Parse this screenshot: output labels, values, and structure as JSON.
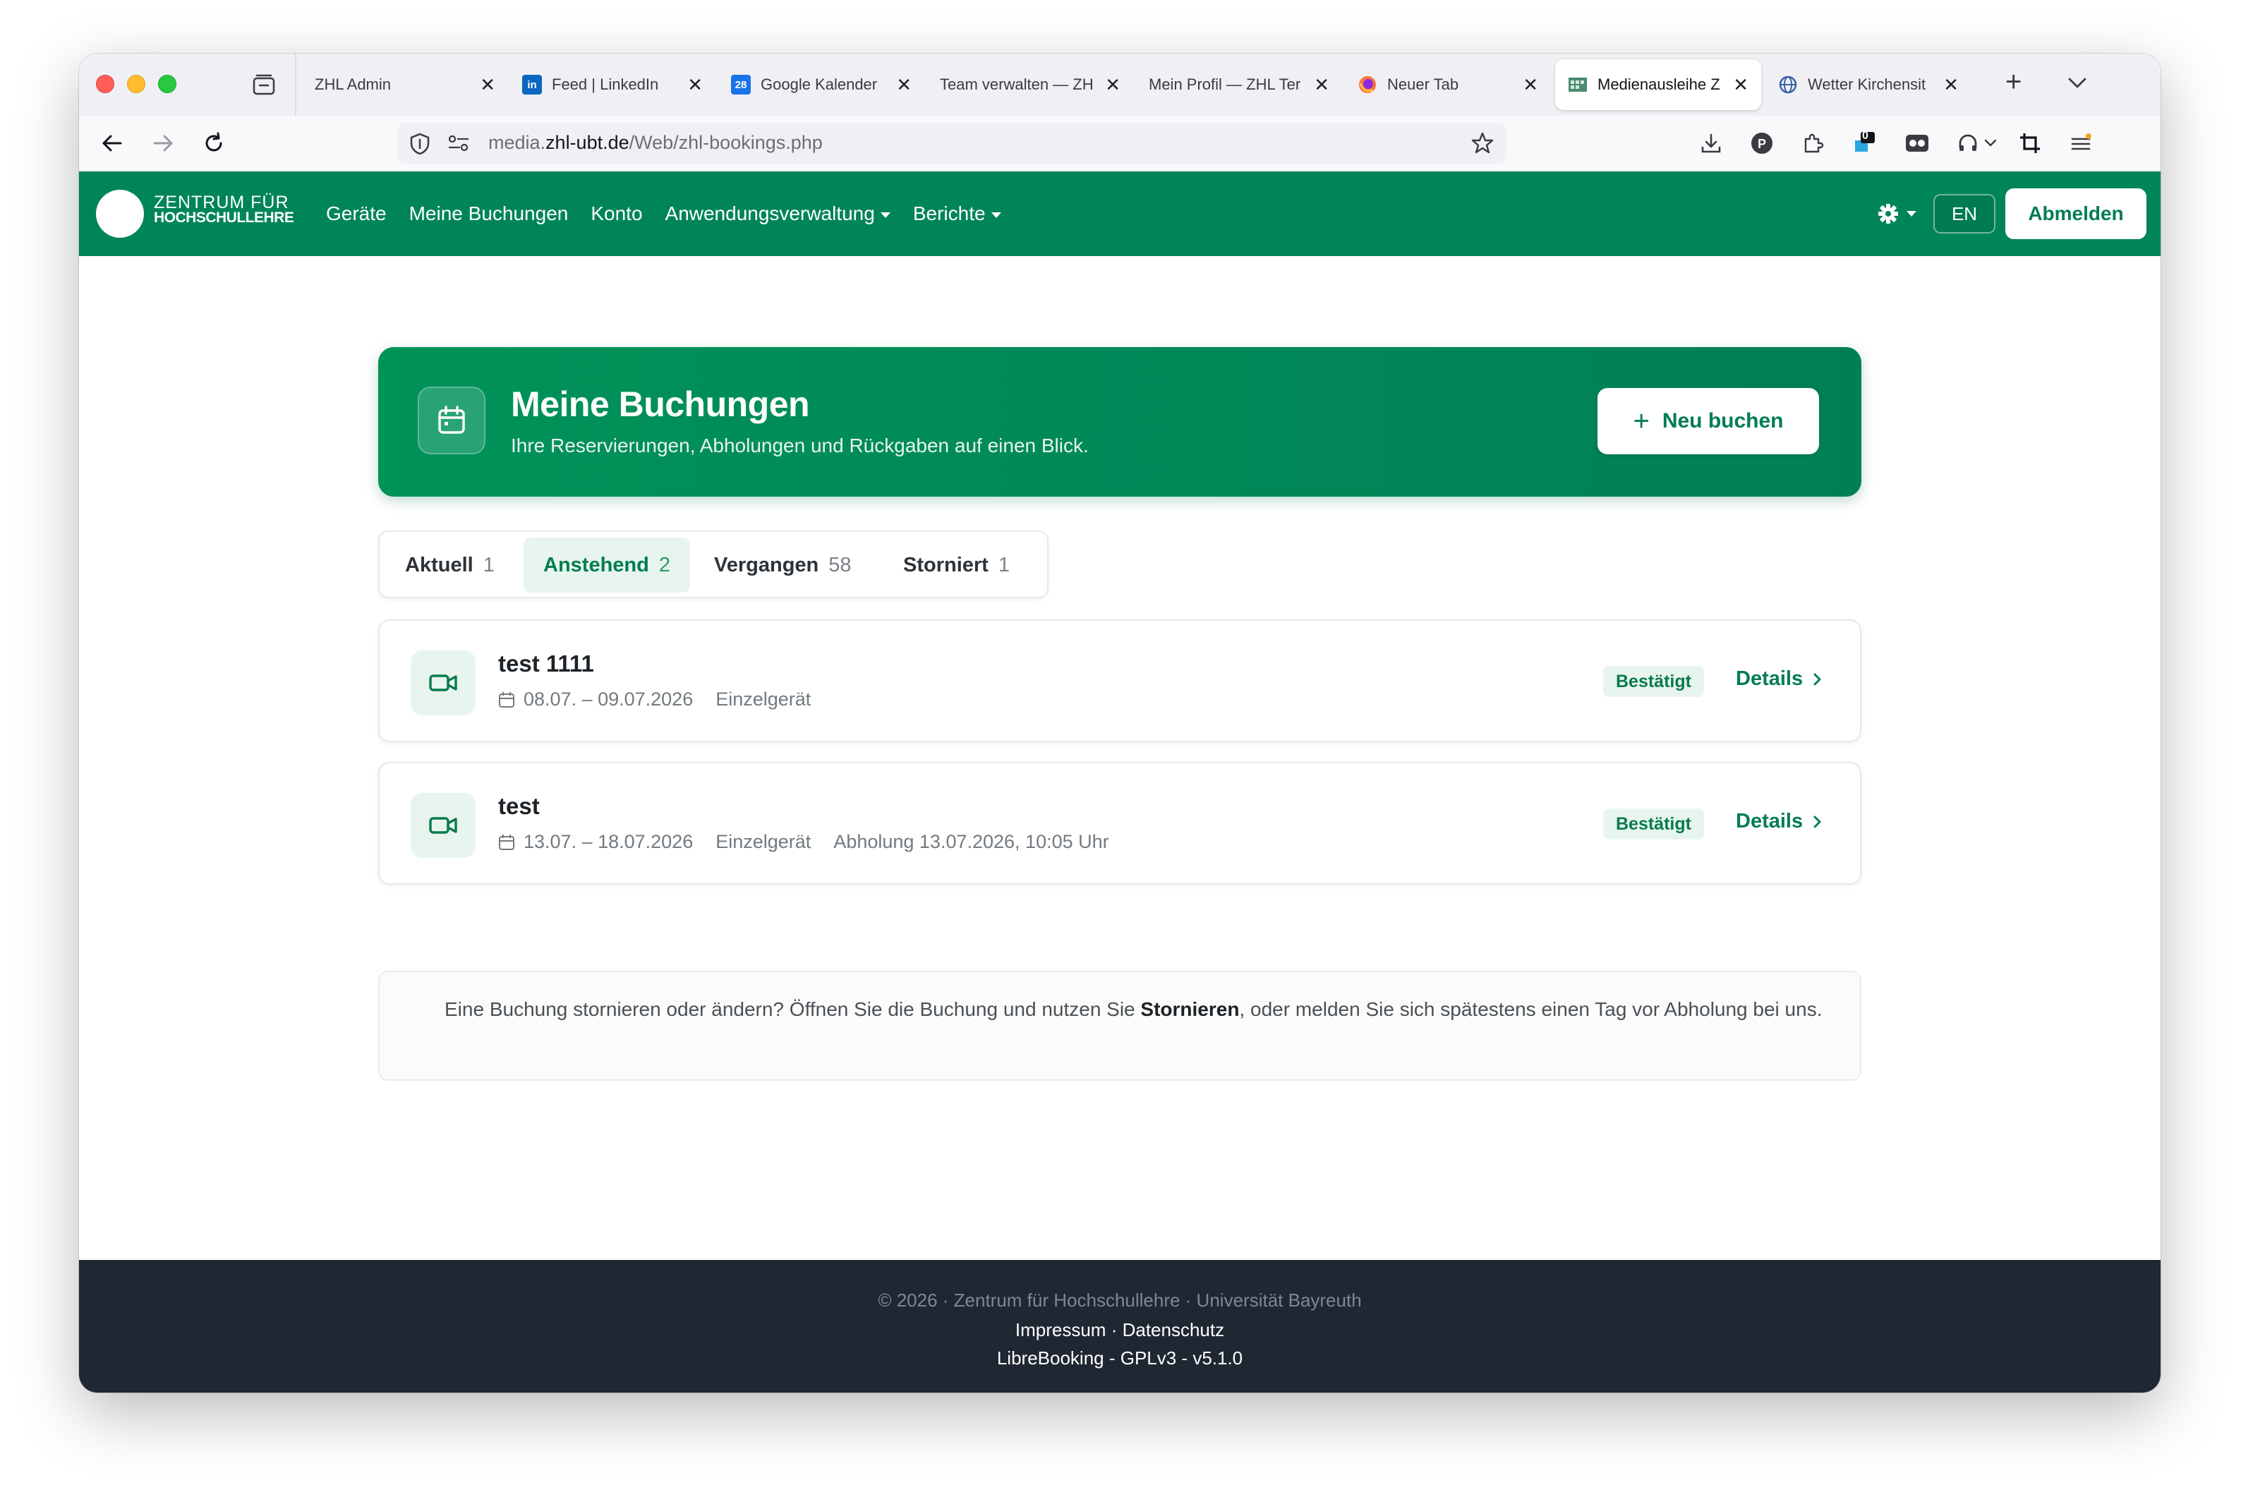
{
  "browser": {
    "tabs": [
      {
        "title": "ZHL Admin",
        "favicon": "blank-icon",
        "active": false
      },
      {
        "title": "Feed | LinkedIn",
        "favicon": "linkedin-icon",
        "active": false
      },
      {
        "title": "Google Kalender",
        "favicon": "google-calendar-icon",
        "favicon_text": "28",
        "active": false
      },
      {
        "title": "Team verwalten — ZH",
        "favicon": "blank-icon",
        "active": false
      },
      {
        "title": "Mein Profil — ZHL Ter",
        "favicon": "blank-icon",
        "active": false
      },
      {
        "title": "Neuer Tab",
        "favicon": "firefox-icon",
        "active": false
      },
      {
        "title": "Medienausleihe Z",
        "favicon": "media-site-icon",
        "active": true
      },
      {
        "title": "Wetter Kirchensit",
        "favicon": "globe-icon",
        "active": false
      }
    ],
    "url_prefix": "media.",
    "url_host": "zhl-ubt.de",
    "url_path": "/Web/zhl-bookings.php",
    "extension_badge": "0"
  },
  "site": {
    "logo_line1": "ZENTRUM FÜR",
    "logo_line2": "HOCHSCHULLEHRE",
    "menu": {
      "devices": "Geräte",
      "my_bookings": "Meine Buchungen",
      "account": "Konto",
      "app_admin": "Anwendungsverwaltung",
      "reports": "Berichte"
    },
    "lang": "EN",
    "logout": "Abmelden",
    "accent": "#008557"
  },
  "hero": {
    "title": "Meine Buchungen",
    "subtitle": "Ihre Reservierungen, Abholungen und Rückgaben auf einen Blick.",
    "new_booking": "Neu buchen"
  },
  "filter_tabs": [
    {
      "label": "Aktuell",
      "count": "1",
      "active": false
    },
    {
      "label": "Anstehend",
      "count": "2",
      "active": true
    },
    {
      "label": "Vergangen",
      "count": "58",
      "active": false
    },
    {
      "label": "Storniert",
      "count": "1",
      "active": false
    }
  ],
  "bookings": [
    {
      "title": "test 1111",
      "dates": "08.07. – 09.07.2026",
      "type": "Einzelgerät",
      "pickup": "",
      "status": "Bestätigt",
      "details": "Details"
    },
    {
      "title": "test",
      "dates": "13.07. – 18.07.2026",
      "type": "Einzelgerät",
      "pickup": "Abholung 13.07.2026, 10:05 Uhr",
      "status": "Bestätigt",
      "details": "Details"
    }
  ],
  "note": {
    "before": "Eine Buchung stornieren oder ändern? Öffnen Sie die Buchung und nutzen Sie ",
    "bold": "Stornieren",
    "after": ", oder melden Sie sich spätestens einen Tag vor Abholung bei uns."
  },
  "footer": {
    "copyright": "© 2026 · Zentrum für Hochschullehre · Universität Bayreuth",
    "impressum": "Impressum",
    "separator": " · ",
    "privacy": "Datenschutz",
    "version": "LibreBooking - GPLv3 - v5.1.0"
  }
}
